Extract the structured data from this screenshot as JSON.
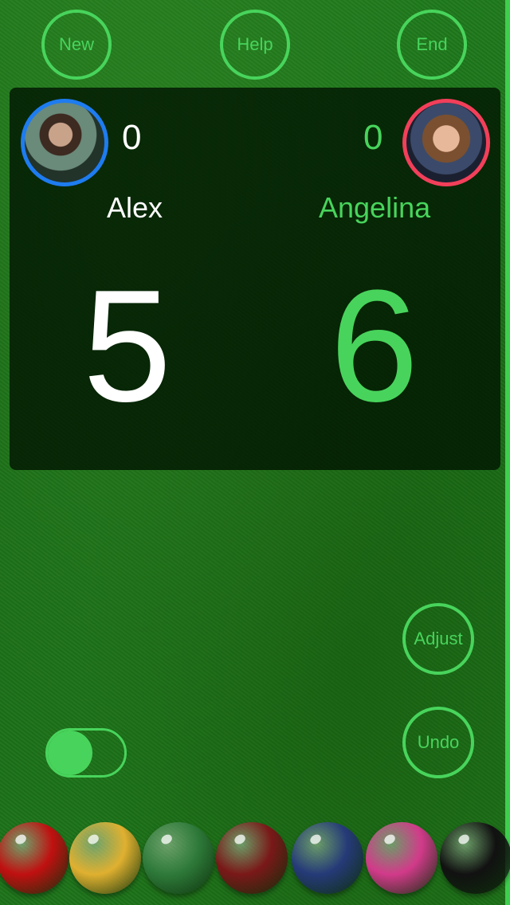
{
  "top_buttons": {
    "new": "New",
    "help": "Help",
    "end": "End"
  },
  "players": {
    "left": {
      "name": "Alex",
      "frames": "0",
      "score": "5",
      "ring_color": "#1e7cf0",
      "avatar": "player-photo"
    },
    "right": {
      "name": "Angelina",
      "frames": "0",
      "score": "6",
      "ring_color": "#f23f5a",
      "avatar": "player-photo"
    }
  },
  "side_buttons": {
    "adjust": "Adjust",
    "undo": "Undo"
  },
  "toggle": {
    "state": "off",
    "color": "#48d45c"
  },
  "balls": [
    {
      "name": "red",
      "color": "#c01010"
    },
    {
      "name": "yellow",
      "color": "#e0b030"
    },
    {
      "name": "green",
      "color": "#2e7a3a"
    },
    {
      "name": "brown",
      "color": "#7a1818"
    },
    {
      "name": "blue",
      "color": "#253a78"
    },
    {
      "name": "pink",
      "color": "#d23a8a"
    },
    {
      "name": "black",
      "color": "#111111"
    }
  ],
  "colors": {
    "accent": "#48d45c",
    "panel": "#001200"
  }
}
